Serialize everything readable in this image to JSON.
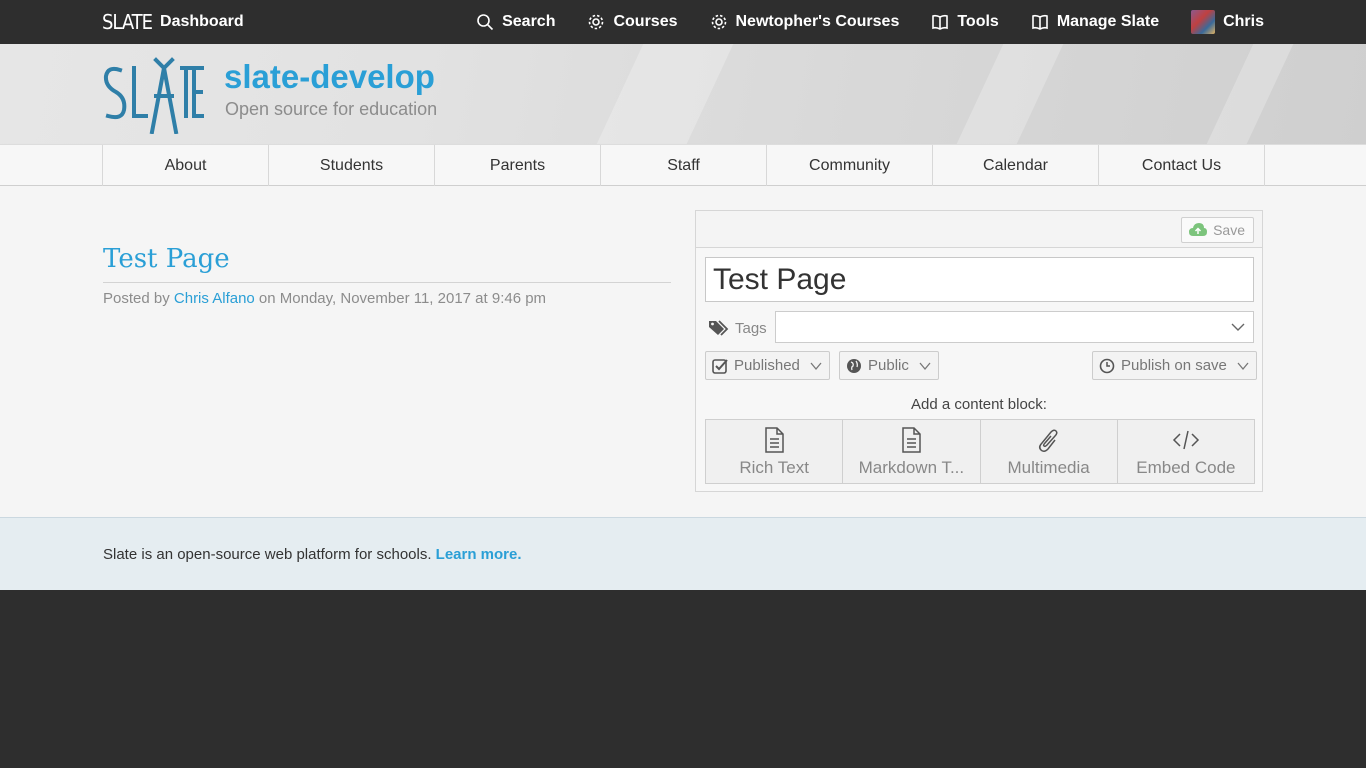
{
  "topbar": {
    "brand_logo": "SLATE",
    "brand_label": "Dashboard",
    "nav": [
      {
        "label": "Search",
        "icon": "search-icon"
      },
      {
        "label": "Courses",
        "icon": "gear-icon"
      },
      {
        "label": "Newtopher's Courses",
        "icon": "gear-icon"
      },
      {
        "label": "Tools",
        "icon": "book-icon"
      },
      {
        "label": "Manage Slate",
        "icon": "book-icon"
      },
      {
        "label": "Chris",
        "icon": "avatar"
      }
    ]
  },
  "header": {
    "site_title": "slate-develop",
    "site_subtitle": "Open source for education"
  },
  "mainnav": {
    "items": [
      "About",
      "Students",
      "Parents",
      "Staff",
      "Community",
      "Calendar",
      "Contact Us"
    ]
  },
  "post": {
    "title": "Test Page",
    "meta_prefix": "Posted by ",
    "author": "Chris Alfano",
    "meta_suffix": " on Monday, November 11, 2017 at 9:46 pm"
  },
  "editor": {
    "save_label": "Save",
    "title_value": "Test Page",
    "tags_label": "Tags",
    "status_label": "Published",
    "visibility_label": "Public",
    "publish_label": "Publish on save",
    "add_block_label": "Add a content block:",
    "blocks": [
      {
        "label": "Rich Text",
        "icon": "document-icon"
      },
      {
        "label": "Markdown T...",
        "icon": "document-icon"
      },
      {
        "label": "Multimedia",
        "icon": "paperclip-icon"
      },
      {
        "label": "Embed Code",
        "icon": "code-icon"
      }
    ]
  },
  "footer": {
    "text": "Slate is an open-source web platform for schools. ",
    "link": "Learn more."
  },
  "colors": {
    "accent": "#2a9fd6",
    "topbar": "#2e2e2e",
    "footer_bg": "#e5edf1"
  }
}
